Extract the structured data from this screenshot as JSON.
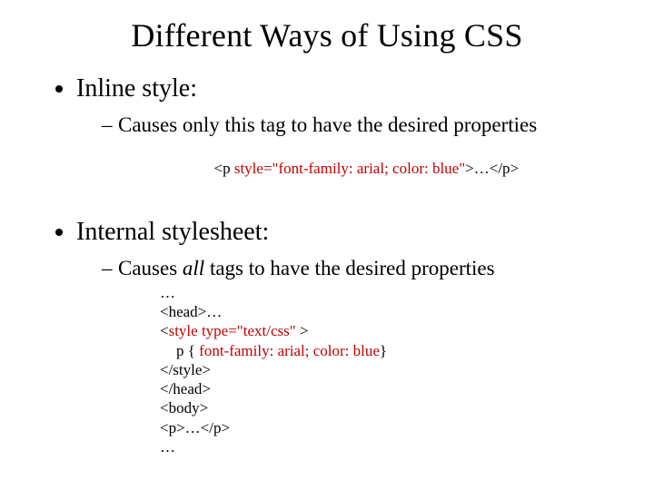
{
  "title": "Different Ways of Using CSS",
  "bullets": [
    {
      "label": "Inline style:",
      "sub": {
        "text": "Causes only this tag to have the desired properties",
        "code": {
          "pre": "<p ",
          "highlight": "style=\"font-family: arial; color: blue\"",
          "post": ">…</p>"
        }
      }
    },
    {
      "label": "Internal stylesheet:",
      "sub": {
        "text_a": "Causes ",
        "text_em": "all",
        "text_b": " tags to have the desired properties",
        "code_lines": {
          "l0": "…",
          "l1": "<head>…",
          "l2a": "<",
          "l2b": "style type=\"text/css\" ",
          "l2c": ">",
          "l3a": "p { ",
          "l3b": "font-family: arial; color: blue",
          "l3c": "}",
          "l4": "</style>",
          "l5": "</head>",
          "l6": "<body>",
          "l7": "<p>…</p>",
          "l8": "…"
        }
      }
    }
  ]
}
